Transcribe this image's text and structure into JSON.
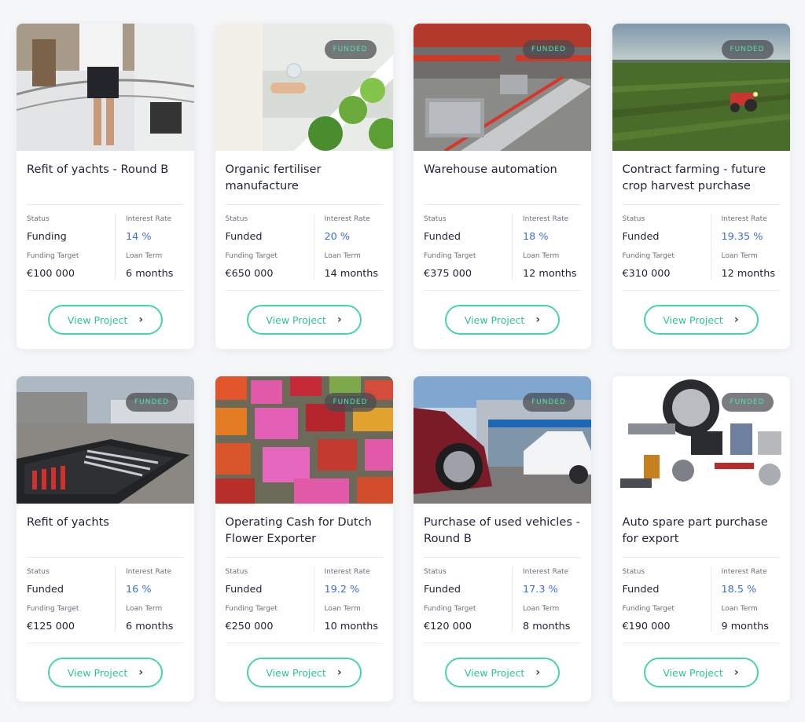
{
  "colors": {
    "accent_green": "#47d6a0",
    "rate_blue": "#3b6fd9",
    "badge_bg": "#464a50"
  },
  "labels": {
    "status": "Status",
    "interest_rate": "Interest Rate",
    "funding_target": "Funding Target",
    "loan_term": "Loan Term",
    "view_project": "View Project",
    "chevron_icon": "chevron-right-icon"
  },
  "projects": [
    {
      "title": "Refit of yachts - Round B",
      "badge": "",
      "status": "Funding",
      "interest_rate": "14 %",
      "funding_target": "€100 000",
      "loan_term": "6 months",
      "image": "yacht-deck-photo"
    },
    {
      "title": "Organic fertiliser manufacture",
      "badge": "FUNDED",
      "status": "Funded",
      "interest_rate": "20 %",
      "funding_target": "€650 000",
      "loan_term": "14 months",
      "image": "hydroponic-plants-photo"
    },
    {
      "title": "Warehouse automation",
      "badge": "FUNDED",
      "status": "Funded",
      "interest_rate": "18 %",
      "funding_target": "€375 000",
      "loan_term": "12 months",
      "image": "warehouse-conveyor-photo"
    },
    {
      "title": "Contract farming - future crop harvest purchase",
      "badge": "FUNDED",
      "status": "Funded",
      "interest_rate": "19.35 %",
      "funding_target": "€310 000",
      "loan_term": "12 months",
      "image": "tractor-field-photo"
    },
    {
      "title": "Refit of yachts",
      "badge": "FUNDED",
      "status": "Funded",
      "interest_rate": "16 %",
      "funding_target": "€125 000",
      "loan_term": "6 months",
      "image": "toolbox-marina-photo"
    },
    {
      "title": "Operating Cash for Dutch Flower Exporter",
      "badge": "FUNDED",
      "status": "Funded",
      "interest_rate": "19.2 %",
      "funding_target": "€250 000",
      "loan_term": "10 months",
      "image": "flower-crates-photo"
    },
    {
      "title": "Purchase of used vehicles - Round B",
      "badge": "FUNDED",
      "status": "Funded",
      "interest_rate": "17.3 %",
      "funding_target": "€120 000",
      "loan_term": "8 months",
      "image": "cars-dealership-photo"
    },
    {
      "title": "Auto spare part purchase for export",
      "badge": "FUNDED",
      "status": "Funded",
      "interest_rate": "18.5 %",
      "funding_target": "€190 000",
      "loan_term": "9 months",
      "image": "auto-parts-photo"
    }
  ]
}
